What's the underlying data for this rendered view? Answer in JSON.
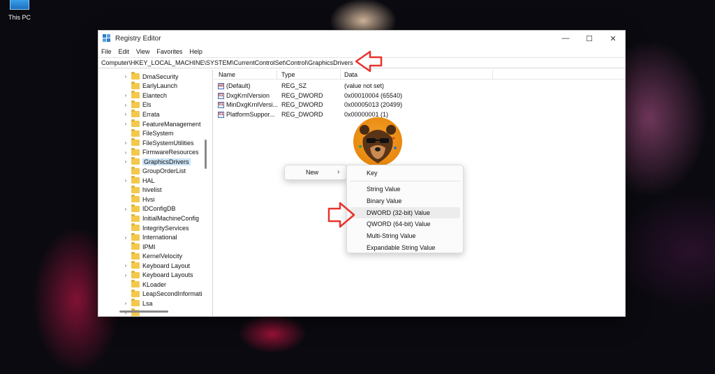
{
  "desktop": {
    "icon_label": "This PC"
  },
  "window": {
    "title": "Registry Editor",
    "controls": {
      "minimize": "—",
      "maximize": "☐",
      "close": "✕"
    }
  },
  "menu": [
    "File",
    "Edit",
    "View",
    "Favorites",
    "Help"
  ],
  "address": "Computer\\HKEY_LOCAL_MACHINE\\SYSTEM\\CurrentControlSet\\Control\\GraphicsDrivers",
  "tree": [
    {
      "name": "DmaSecurity",
      "expandable": true
    },
    {
      "name": "EarlyLaunch",
      "expandable": false
    },
    {
      "name": "Elantech",
      "expandable": true
    },
    {
      "name": "Els",
      "expandable": true
    },
    {
      "name": "Errata",
      "expandable": true
    },
    {
      "name": "FeatureManagement",
      "expandable": true
    },
    {
      "name": "FileSystem",
      "expandable": false
    },
    {
      "name": "FileSystemUtilities",
      "expandable": true
    },
    {
      "name": "FirmwareResources",
      "expandable": true
    },
    {
      "name": "GraphicsDrivers",
      "expandable": true,
      "selected": true
    },
    {
      "name": "GroupOrderList",
      "expandable": false
    },
    {
      "name": "HAL",
      "expandable": true
    },
    {
      "name": "hivelist",
      "expandable": false
    },
    {
      "name": "Hvsi",
      "expandable": false
    },
    {
      "name": "IDConfigDB",
      "expandable": true
    },
    {
      "name": "InitialMachineConfig",
      "expandable": false
    },
    {
      "name": "IntegrityServices",
      "expandable": false
    },
    {
      "name": "International",
      "expandable": true
    },
    {
      "name": "IPMI",
      "expandable": false
    },
    {
      "name": "KernelVelocity",
      "expandable": false
    },
    {
      "name": "Keyboard Layout",
      "expandable": true
    },
    {
      "name": "Keyboard Layouts",
      "expandable": true
    },
    {
      "name": "KLoader",
      "expandable": false
    },
    {
      "name": "LeapSecondInformati",
      "expandable": false
    },
    {
      "name": "Lsa",
      "expandable": true
    },
    {
      "name": "",
      "expandable": true
    }
  ],
  "list": {
    "columns": [
      "Name",
      "Type",
      "Data"
    ],
    "rows": [
      {
        "name": "(Default)",
        "type": "REG_SZ",
        "data": "(value not set)",
        "icon": "ab"
      },
      {
        "name": "DxgKrnlVersion",
        "type": "REG_DWORD",
        "data": "0x00010004 (65540)",
        "icon": "01"
      },
      {
        "name": "MinDxgKrnlVersi...",
        "type": "REG_DWORD",
        "data": "0x00005013 (20499)",
        "icon": "01"
      },
      {
        "name": "PlatformSuppor...",
        "type": "REG_DWORD",
        "data": "0x00000001 (1)",
        "icon": "01"
      }
    ]
  },
  "context_menu": {
    "new_label": "New",
    "new_arrow": "›",
    "submenu": {
      "key": "Key",
      "values": [
        "String Value",
        "Binary Value",
        "DWORD (32-bit) Value",
        "QWORD (64-bit) Value",
        "Multi-String Value",
        "Expandable String Value"
      ],
      "highlighted": "DWORD (32-bit) Value"
    }
  },
  "colors": {
    "annotation_arrow": "#e8322e",
    "folder": "#f2c94c",
    "selection": "#cce4f7"
  }
}
